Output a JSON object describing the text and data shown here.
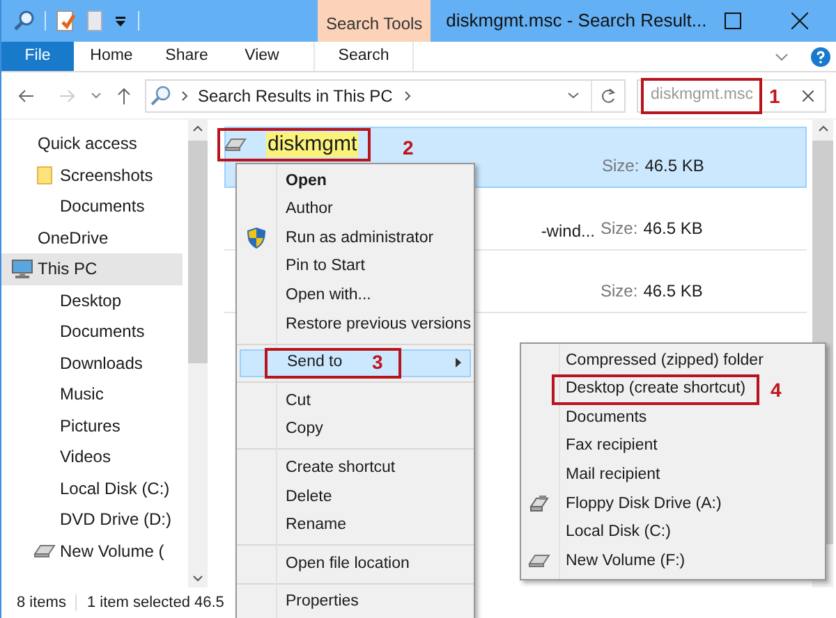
{
  "window": {
    "title": "diskmgmt.msc - Search Result...",
    "context_tab": "Search Tools"
  },
  "ribbon_tabs": [
    {
      "label": "File",
      "kind": "file",
      "selected": false
    },
    {
      "label": "Home",
      "kind": "plain",
      "selected": false
    },
    {
      "label": "Share",
      "kind": "plain",
      "selected": false
    },
    {
      "label": "View",
      "kind": "plain",
      "selected": false
    },
    {
      "label": "Search",
      "kind": "context",
      "selected": false
    }
  ],
  "navigation": {
    "forward_disabled": true
  },
  "address": {
    "path": "Search Results in This PC"
  },
  "search": {
    "value": "diskmgmt.msc"
  },
  "sidebar": {
    "items": [
      {
        "label": "Quick access",
        "kind": "plain",
        "selected": false,
        "children": [
          {
            "label": "Screenshots",
            "kind": "folder",
            "selected": false
          },
          {
            "label": "Documents",
            "kind": "plain",
            "selected": false
          }
        ]
      },
      {
        "label": "OneDrive",
        "kind": "plain",
        "selected": false
      },
      {
        "label": "This PC",
        "kind": "pc",
        "selected": true,
        "children": [
          {
            "label": "Desktop",
            "kind": "plain",
            "selected": false
          },
          {
            "label": "Documents",
            "kind": "plain",
            "selected": false
          },
          {
            "label": "Downloads",
            "kind": "plain",
            "selected": false
          },
          {
            "label": "Music",
            "kind": "plain",
            "selected": false
          },
          {
            "label": "Pictures",
            "kind": "plain",
            "selected": false
          },
          {
            "label": "Videos",
            "kind": "plain",
            "selected": false
          },
          {
            "label": "Local Disk (C:)",
            "kind": "plain",
            "selected": false
          },
          {
            "label": "DVD Drive (D:)",
            "kind": "plain",
            "selected": false
          },
          {
            "label": "New Volume (",
            "kind": "drive",
            "selected": false
          }
        ]
      }
    ]
  },
  "results": [
    {
      "name": "diskmgmt",
      "kind": "full",
      "selected": true,
      "size_label": "Size:",
      "size": "46.5 KB"
    },
    {
      "name": "-wind...",
      "kind": "covered",
      "selected": false,
      "size_label": "Size:",
      "size": "46.5 KB"
    },
    {
      "kind": "covered",
      "selected": false,
      "size_label": "Size:",
      "size": "46.5 KB"
    }
  ],
  "status_bar": {
    "count": "8 items",
    "selection": "1 item selected",
    "size": "46.5"
  },
  "context_menu": {
    "groups": [
      [
        {
          "label": "Open",
          "kind": "default",
          "selected": false
        },
        {
          "label": "Author",
          "kind": "normal",
          "selected": false
        },
        {
          "label": "Run as administrator",
          "kind": "shield",
          "selected": false
        },
        {
          "label": "Pin to Start",
          "kind": "normal",
          "selected": false
        },
        {
          "label": "Open with...",
          "kind": "normal",
          "selected": false
        },
        {
          "label": "Restore previous versions",
          "kind": "normal",
          "selected": false
        }
      ],
      [
        {
          "label": "Send to",
          "kind": "submenu",
          "selected": true
        }
      ],
      [
        {
          "label": "Cut",
          "kind": "normal",
          "selected": false
        },
        {
          "label": "Copy",
          "kind": "normal",
          "selected": false
        }
      ],
      [
        {
          "label": "Create shortcut",
          "kind": "normal",
          "selected": false
        },
        {
          "label": "Delete",
          "kind": "normal",
          "selected": false
        },
        {
          "label": "Rename",
          "kind": "normal",
          "selected": false
        }
      ],
      [
        {
          "label": "Open file location",
          "kind": "normal",
          "selected": false
        }
      ],
      [
        {
          "label": "Properties",
          "kind": "normal",
          "selected": false
        }
      ]
    ]
  },
  "send_to_menu": {
    "items": [
      {
        "label": "Compressed (zipped) folder",
        "kind": "plain"
      },
      {
        "label": "Desktop (create shortcut)",
        "kind": "plain"
      },
      {
        "label": "Documents",
        "kind": "plain"
      },
      {
        "label": "Fax recipient",
        "kind": "plain"
      },
      {
        "label": "Mail recipient",
        "kind": "plain"
      },
      {
        "label": "Floppy Disk Drive (A:)",
        "kind": "floppy"
      },
      {
        "label": "Local Disk (C:)",
        "kind": "plain"
      },
      {
        "label": "New Volume (F:)",
        "kind": "drive"
      }
    ]
  },
  "annotations": [
    "1",
    "2",
    "3",
    "4"
  ]
}
